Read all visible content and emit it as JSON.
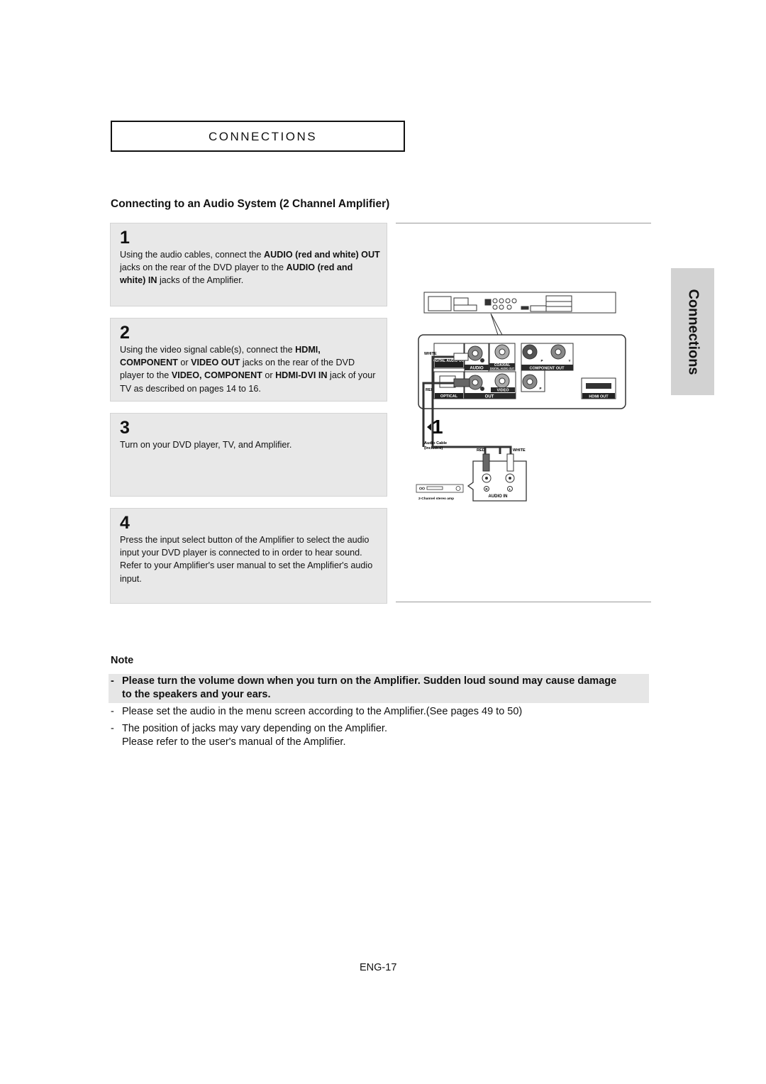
{
  "header": {
    "title": "CONNECTIONS"
  },
  "section_title": "Connecting to an Audio System (2 Channel Amplifier)",
  "side_tab": "Connections",
  "steps": [
    {
      "number": "1",
      "segments": [
        {
          "text": "Using the audio cables, connect the ",
          "bold": false
        },
        {
          "text": "AUDIO (red and white) OUT",
          "bold": true
        },
        {
          "text": " jacks on the rear of the DVD player to the ",
          "bold": false
        },
        {
          "text": "AUDIO (red and white) IN",
          "bold": true
        },
        {
          "text": " jacks of the Amplifier.",
          "bold": false
        }
      ]
    },
    {
      "number": "2",
      "segments": [
        {
          "text": "Using the video signal cable(s), connect the ",
          "bold": false
        },
        {
          "text": "HDMI, COMPONENT",
          "bold": true
        },
        {
          "text": " or ",
          "bold": false
        },
        {
          "text": "VIDEO OUT",
          "bold": true
        },
        {
          "text": " jacks on the rear of the DVD player to the ",
          "bold": false
        },
        {
          "text": "VIDEO, COMPONENT",
          "bold": true
        },
        {
          "text": " or ",
          "bold": false
        },
        {
          "text": "HDMI-DVI IN",
          "bold": true
        },
        {
          "text": " jack of your TV as described on pages 14 to 16.",
          "bold": false
        }
      ]
    },
    {
      "number": "3",
      "segments": [
        {
          "text": "Turn on your DVD player, TV, and Amplifier.",
          "bold": false
        }
      ]
    },
    {
      "number": "4",
      "segments": [
        {
          "text": "Press the input select button of the Amplifier to select the audio input your DVD player is connected to in order to hear sound. Refer to your Amplifier's user manual to set the Amplifier's audio input.",
          "bold": false
        }
      ]
    }
  ],
  "diagram": {
    "white": "WHITE",
    "digital_audio_out": "DIGITAL AUDIO OUT",
    "audio": "AUDIO",
    "coaxial": "COAXIAL",
    "coaxial_sub": "DIGITAL AUDIO OUT",
    "component_out": "COMPONENT OUT",
    "red": "RED",
    "optical": "OPTICAL",
    "video": "VIDEO",
    "out": "OUT",
    "hdmi_out": "HDMI OUT",
    "pb": "P",
    "y": "Y",
    "pr": "P",
    "step_marker": "1",
    "audio_cable": "Audio Cable",
    "included": "(Included)",
    "cable_red": "RED",
    "cable_white": "WHITE",
    "jack_r": "R",
    "jack_l": "L",
    "audio_in": "AUDIO IN",
    "amp_label": "2-Channel stereo amp"
  },
  "note": {
    "title": "Note",
    "items": [
      {
        "dash": "-",
        "text": "Please turn the volume down when you turn on the Amplifier. Sudden loud sound may cause damage to the speakers and your ears.",
        "bold": true
      },
      {
        "dash": "-",
        "text": "Please set the audio in the menu screen according to the Amplifier.(See pages 49 to 50)",
        "bold": false
      },
      {
        "dash": "-",
        "text": "The position of jacks may vary depending on the Amplifier.",
        "text2": "Please refer to the user's manual of the Amplifier.",
        "bold": false
      }
    ]
  },
  "page_number": "ENG-17"
}
